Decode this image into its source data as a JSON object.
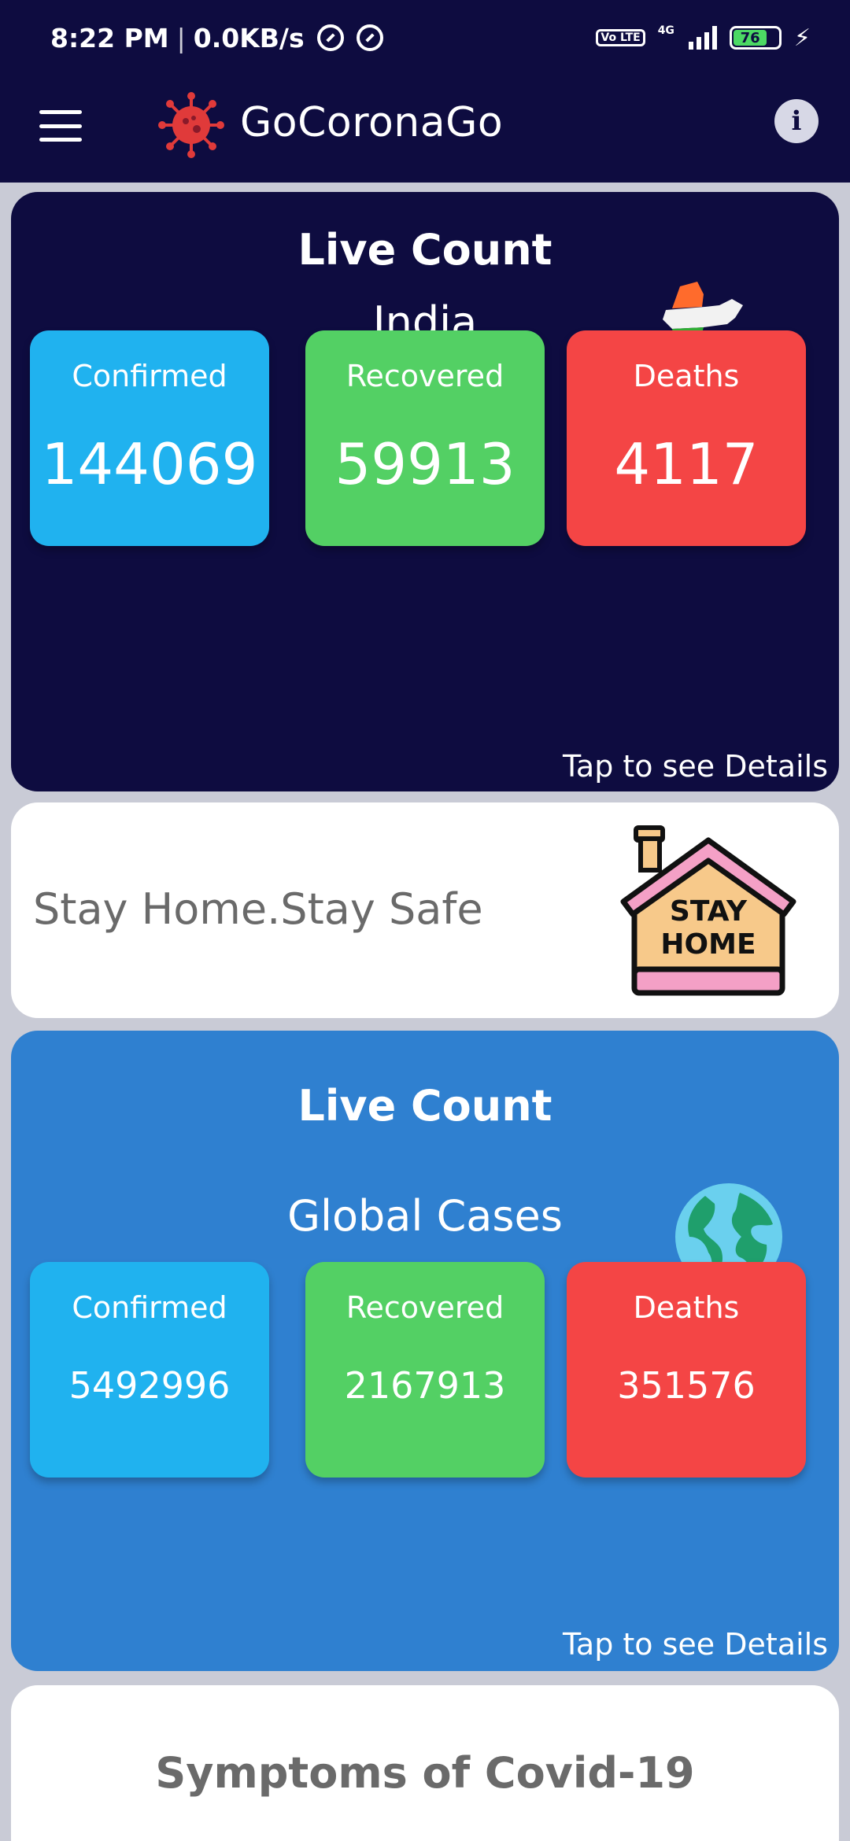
{
  "status_bar": {
    "time": "8:22 PM",
    "separator": "|",
    "speed": "0.0KB/s",
    "network_type": "4G",
    "volte": "Vo LTE",
    "battery_percent": "76"
  },
  "app_bar": {
    "title": "GoCoronaGo",
    "info_label": "i"
  },
  "india": {
    "title": "Live Count",
    "region": "India",
    "stats": {
      "confirmed_label": "Confirmed",
      "confirmed_value": "144069",
      "recovered_label": "Recovered",
      "recovered_value": "59913",
      "deaths_label": "Deaths",
      "deaths_value": "4117"
    },
    "details_link": "Tap to see Details"
  },
  "stay_home": {
    "text": "Stay Home.Stay Safe",
    "sign_line1": "STAY",
    "sign_line2": "HOME"
  },
  "global": {
    "title": "Live Count",
    "region": "Global Cases",
    "stats": {
      "confirmed_label": "Confirmed",
      "confirmed_value": "5492996",
      "recovered_label": "Recovered",
      "recovered_value": "2167913",
      "deaths_label": "Deaths",
      "deaths_value": "351576"
    },
    "details_link": "Tap to see Details"
  },
  "symptoms": {
    "title": "Symptoms of Covid-19"
  },
  "colors": {
    "dark_navy": "#0e0c40",
    "global_blue": "#2f80d0",
    "confirmed": "#20b2ef",
    "recovered": "#53d064",
    "deaths": "#f44545"
  }
}
